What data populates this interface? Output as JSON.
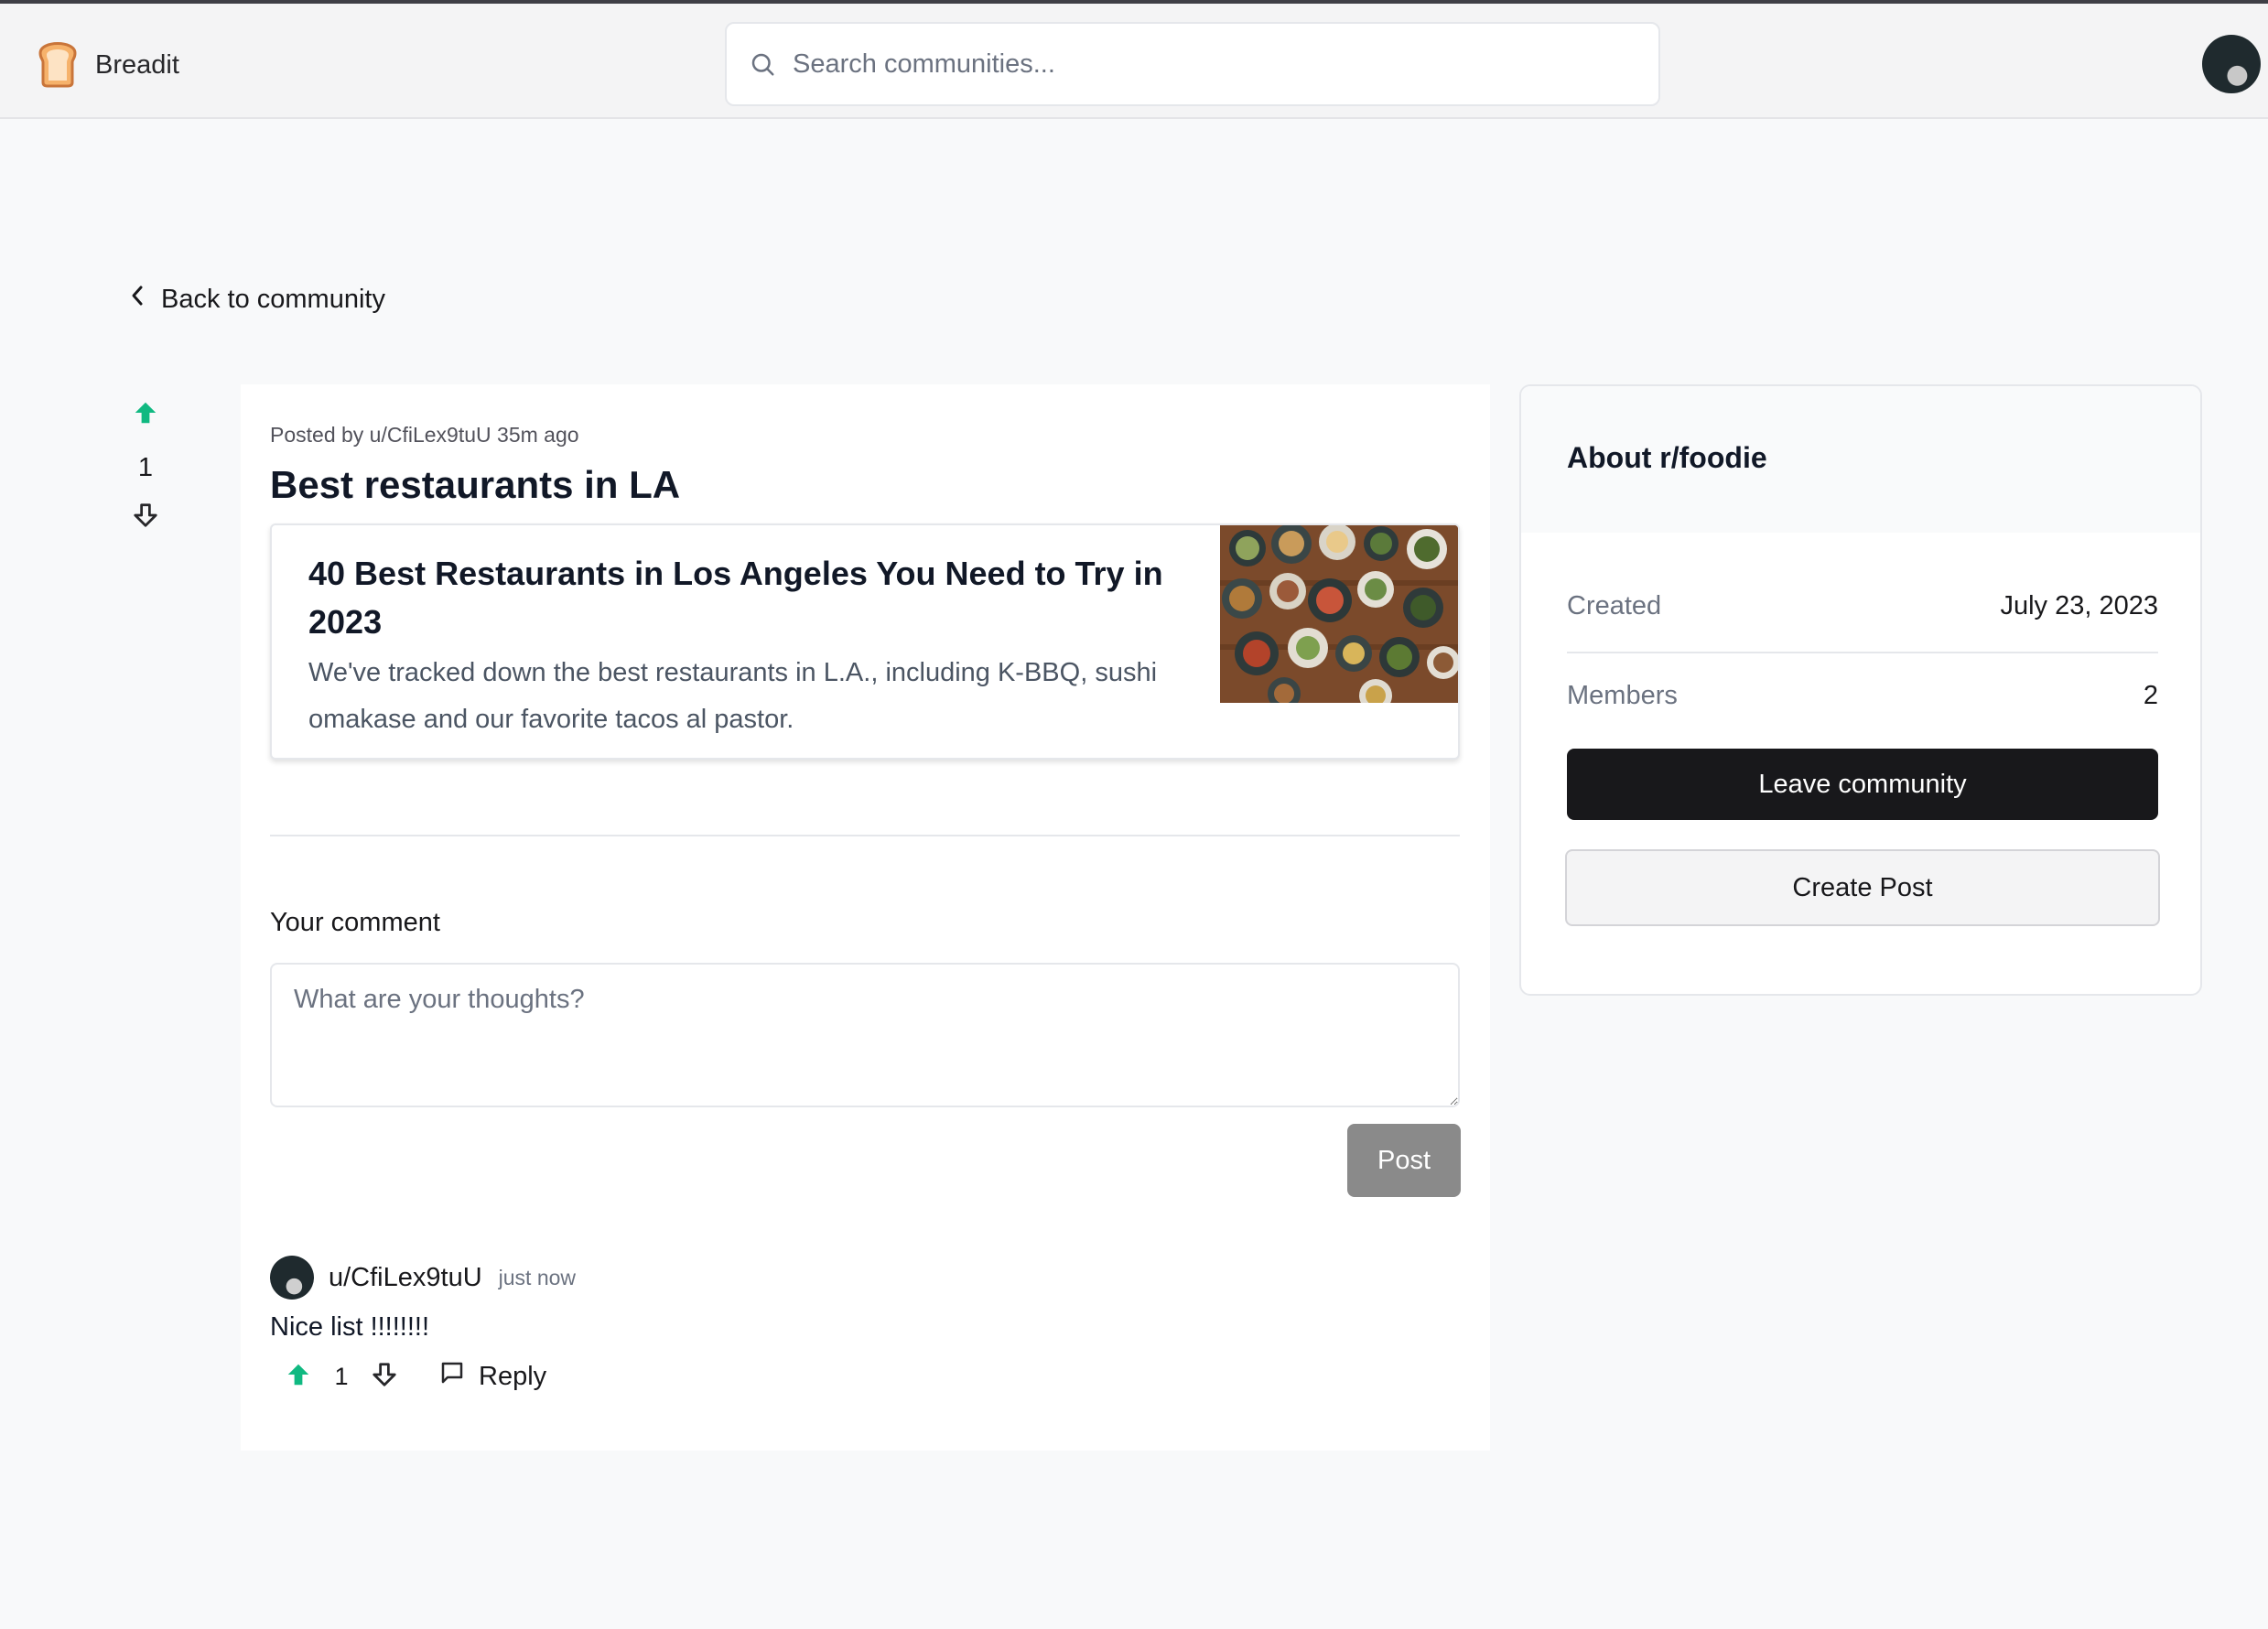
{
  "header": {
    "brand": "Breadit",
    "search_placeholder": "Search communities..."
  },
  "nav": {
    "back_label": "Back to community"
  },
  "post": {
    "votes": "1",
    "meta": "Posted by u/CfiLex9tuU 35m ago",
    "title": "Best restaurants in LA",
    "link": {
      "title": "40 Best Restaurants in Los Angeles You Need to Try in 2023",
      "description": "We've tracked down the best restaurants in L.A., including K-BBQ, sushi omakase and our favorite tacos al pastor."
    }
  },
  "comment_form": {
    "label": "Your comment",
    "placeholder": "What are your thoughts?",
    "submit_label": "Post"
  },
  "comments": [
    {
      "user": "u/CfiLex9tuU",
      "time": "just now",
      "text": "Nice list !!!!!!!!",
      "votes": "1",
      "reply_label": "Reply"
    }
  ],
  "sidebar": {
    "title": "About r/foodie",
    "created_label": "Created",
    "created_value": "July 23, 2023",
    "members_label": "Members",
    "members_value": "2",
    "leave_label": "Leave community",
    "create_post_label": "Create Post"
  },
  "colors": {
    "upvote_active": "#10b981",
    "primary_button": "#18181b",
    "disabled_button": "#8a8a8a"
  }
}
